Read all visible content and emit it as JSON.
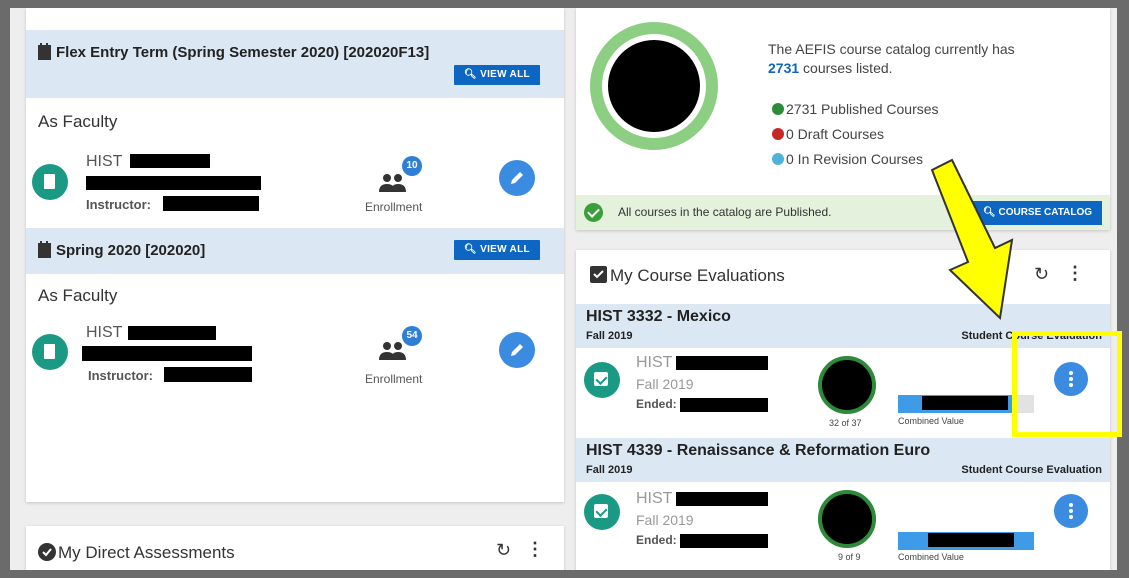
{
  "terms": [
    {
      "title": "Flex Entry Term (Spring Semester 2020) [202020F13]",
      "view_all": "VIEW ALL",
      "role": "As Faculty",
      "course_code": "HIST",
      "instructor_label": "Instructor:",
      "enrollment_count": "10",
      "enrollment_label": "Enrollment"
    },
    {
      "title": "Spring 2020 [202020]",
      "view_all": "VIEW ALL",
      "role": "As Faculty",
      "course_code": "HIST",
      "instructor_label": "Instructor:",
      "enrollment_count": "54",
      "enrollment_label": "Enrollment"
    }
  ],
  "direct_assessments": {
    "title": "My Direct Assessments"
  },
  "catalog": {
    "text_prefix": "The AEFIS course catalog currently has",
    "count": "2731",
    "text_suffix": "courses listed.",
    "published": "2731 Published Courses",
    "draft": "0 Draft Courses",
    "revision": "0 In Revision Courses",
    "published_color": "#2e8b3a",
    "draft_color": "#c62828",
    "revision_color": "#4fb3d9",
    "banner_text": "All courses in the catalog are Published.",
    "button_label": "COURSE CATALOG"
  },
  "evaluations": {
    "title": "My Course Evaluations",
    "items": [
      {
        "title": "HIST 3332 - Mexico",
        "term": "Fall 2019",
        "type": "Student Course Evaluation",
        "course_code": "HIST",
        "sub_term": "Fall 2019",
        "ended_label": "Ended:",
        "count": "32 of 37",
        "combined_label": "Combined Value",
        "progress": 0.865
      },
      {
        "title": "HIST 4339 - Renaissance & Reformation Euro",
        "term": "Fall 2019",
        "type": "Student Course Evaluation",
        "course_code": "HIST",
        "sub_term": "Fall 2019",
        "ended_label": "Ended:",
        "count": "9 of 9",
        "combined_label": "Combined Value",
        "progress": 1
      }
    ]
  },
  "colors": {
    "accent_blue": "#0d66c2",
    "header_bg": "#dbe8f4",
    "teal": "#1a9a84",
    "highlight": "#ffff00"
  }
}
